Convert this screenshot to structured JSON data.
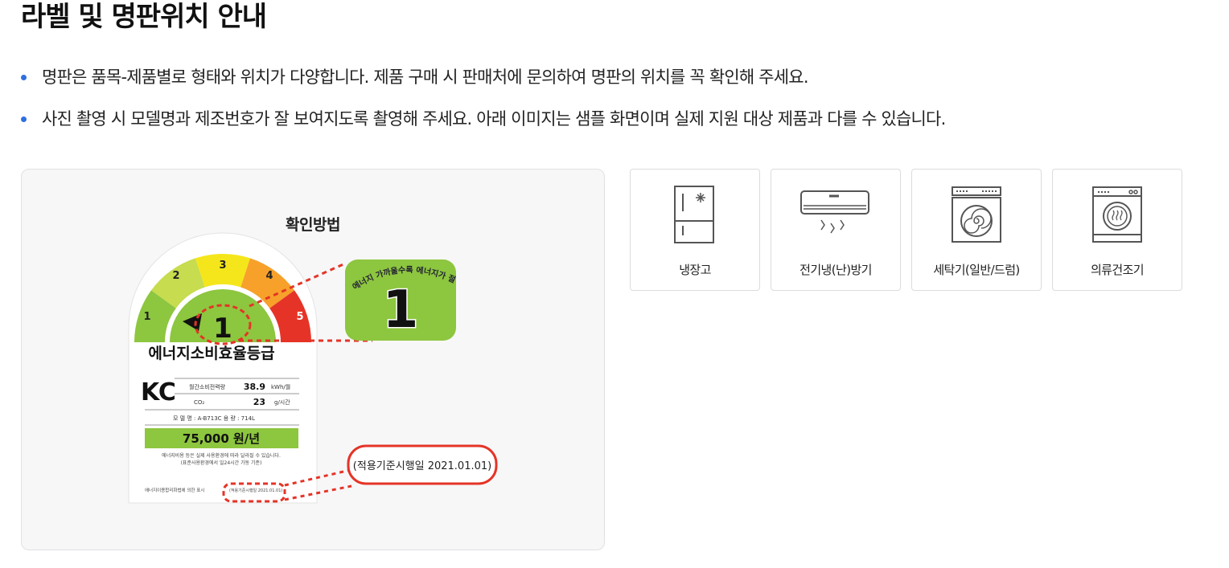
{
  "page": {
    "title": "라벨 및 명판위치 안내"
  },
  "notices": [
    "명판은 품목-제품별로 형태와 위치가 다양합니다. 제품 구매 시 판매처에 문의하여 명판의 위치를 꼭 확인해 주세요.",
    "사진 촬영 시 모델명과 제조번호가 잘 보여지도록 촬영해 주세요. 아래 이미지는 샘플 화면이며 실제 지원 대상 제품과 다를 수 있습니다."
  ],
  "guide": {
    "title": "확인방법",
    "label": {
      "grade_numbers": [
        "1",
        "2",
        "3",
        "4",
        "5"
      ],
      "current_grade": "1",
      "zoom_grade": "1",
      "arc_text": "에너지 가까울수록 에너지가 절약",
      "heading": "에너지소비효율등급",
      "kc_mark": "KC",
      "rows": [
        {
          "label": "월간소비전력량",
          "value": "38.9",
          "unit": "kWh/월"
        },
        {
          "label": "CO₂",
          "value": "23",
          "unit": "g/시간"
        }
      ],
      "model_line": "모 델 명 : A-B713C      용    량 : 714L",
      "cost": "75,000 원/년",
      "fine_print_1": "에너지비용 등은 실제 사용환경에 따라 달라질 수 있습니다.",
      "fine_print_2": "(표준사용환경에서 일24시간 가동 기준)",
      "footer_left": "에너지이용합리화법에 의한 표시",
      "footer_right": "(적용기준시행일 2021.01.01)",
      "callout": "(적용기준시행일 2021.01.01)"
    },
    "colors": {
      "grade1": "#8dc63f",
      "grade2": "#c7dc4e",
      "grade3": "#f5e61b",
      "grade4": "#f7a12a",
      "grade5": "#e53427",
      "dashed_red": "#e53427"
    }
  },
  "products": [
    {
      "name": "냉장고",
      "icon": "refrigerator-icon"
    },
    {
      "name": "전기냉(난)방기",
      "icon": "air-conditioner-icon"
    },
    {
      "name": "세탁기(일반/드럼)",
      "icon": "washing-machine-icon"
    },
    {
      "name": "의류건조기",
      "icon": "clothes-dryer-icon"
    }
  ]
}
